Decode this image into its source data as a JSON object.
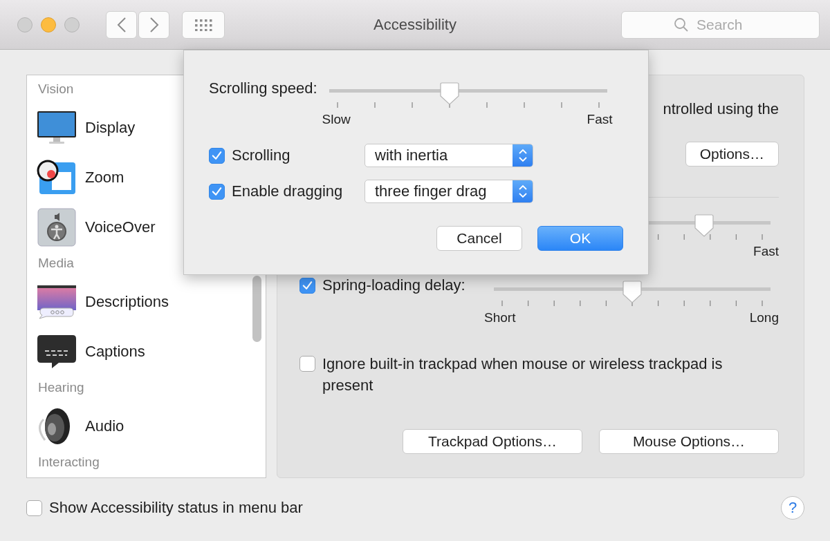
{
  "window": {
    "title": "Accessibility"
  },
  "toolbar": {
    "search": {
      "placeholder": "Search"
    }
  },
  "sidebar": {
    "groups": [
      {
        "label": "Vision",
        "items": [
          {
            "label": "Display",
            "kind": "display"
          },
          {
            "label": "Zoom",
            "kind": "zoom"
          },
          {
            "label": "VoiceOver",
            "kind": "voiceover"
          }
        ]
      },
      {
        "label": "Media",
        "items": [
          {
            "label": "Descriptions",
            "kind": "descriptions"
          },
          {
            "label": "Captions",
            "kind": "captions"
          }
        ]
      },
      {
        "label": "Hearing",
        "items": [
          {
            "label": "Audio",
            "kind": "audio"
          }
        ]
      },
      {
        "label": "Interacting"
      }
    ]
  },
  "panel": {
    "description": "ntrolled using the",
    "options_button": "Options…",
    "speed_slider": {
      "level": 0.78,
      "max_label": "Fast"
    },
    "spring_loading": {
      "label": "Spring-loading delay:",
      "checked": true,
      "level": 0.5,
      "min_label": "Short",
      "max_label": "Long"
    },
    "ignore_trackpad": {
      "label": "Ignore built-in trackpad when mouse or wireless trackpad is present",
      "checked": false
    },
    "buttons": [
      "Trackpad Options…",
      "Mouse Options…"
    ]
  },
  "footer": {
    "status_checkbox": {
      "label": "Show Accessibility status in menu bar",
      "checked": false
    },
    "help": "?"
  },
  "sheet": {
    "speed": {
      "label": "Scrolling speed:",
      "level": 0.43,
      "min_label": "Slow",
      "max_label": "Fast"
    },
    "options": [
      {
        "label": "Scrolling",
        "checked": true,
        "value": "with inertia"
      },
      {
        "label": "Enable dragging",
        "checked": true,
        "value": "three finger drag"
      }
    ],
    "cancel": "Cancel",
    "ok": "OK"
  }
}
